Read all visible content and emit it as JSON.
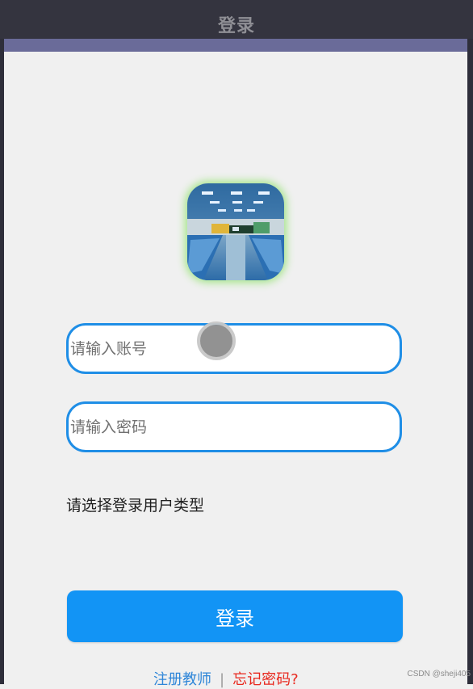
{
  "header": {
    "title": "登录"
  },
  "form": {
    "username_placeholder": "请输入账号",
    "password_placeholder": "请输入密码",
    "user_type_label": "请选择登录用户类型"
  },
  "actions": {
    "login_label": "登录",
    "register_link": "注册教师",
    "separator": "|",
    "forgot_link": "忘记密码?"
  },
  "watermark": "CSDN @sheji405",
  "logo": {
    "icon": "classroom-photo-icon"
  },
  "colors": {
    "titlebar": "#34343f",
    "accent_bar": "#6a6b99",
    "background": "#f0f0f0",
    "input_border": "#1f8ee6",
    "login_button": "#1294f5",
    "register_link": "#2f86d8",
    "forgot_link": "#e8281e"
  }
}
